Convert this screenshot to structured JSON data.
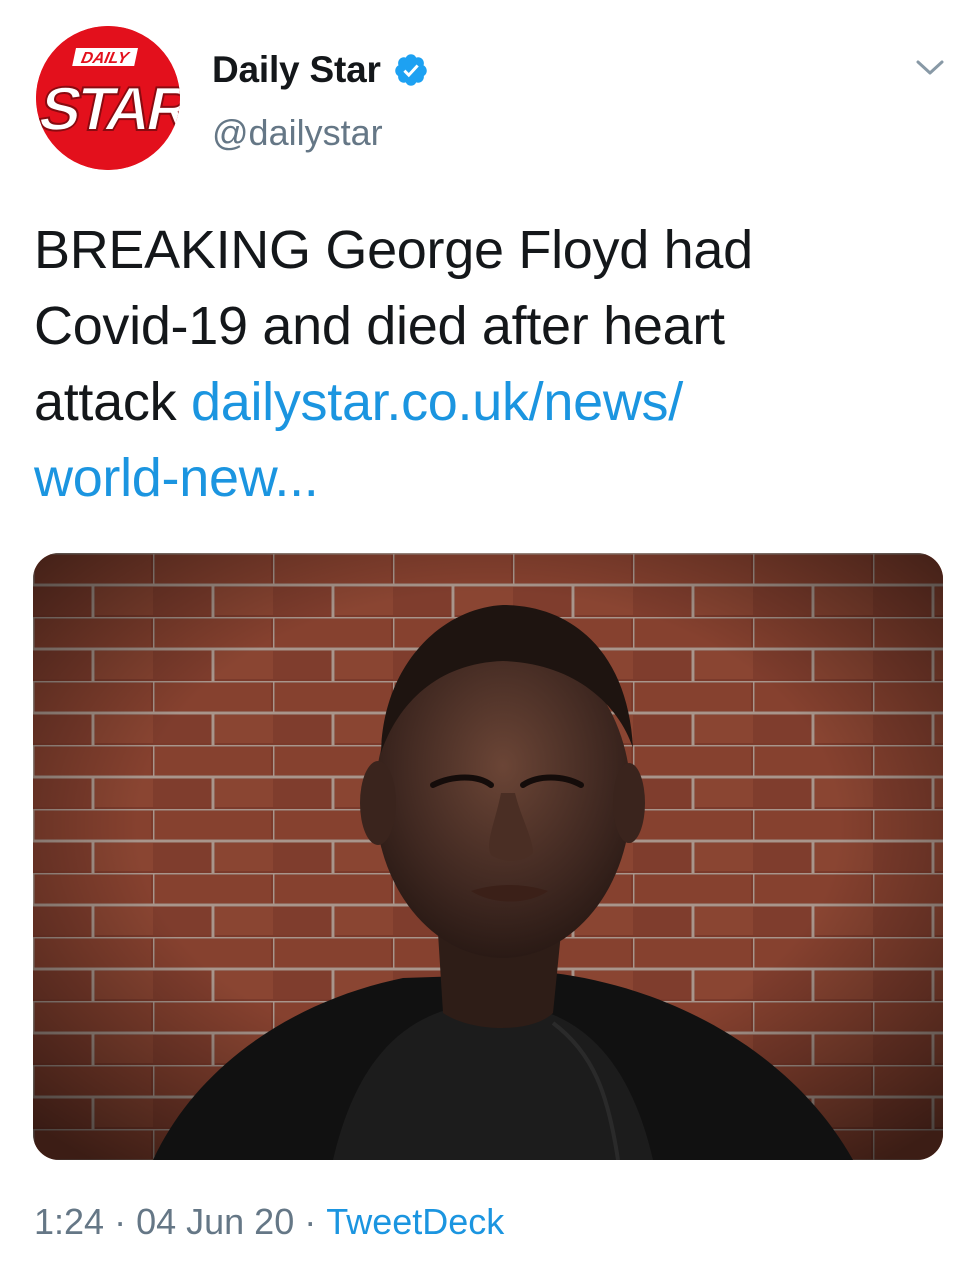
{
  "account": {
    "display_name": "Daily Star",
    "handle": "@dailystar",
    "verified": true,
    "avatar_logo_text": "DAILY STAR",
    "avatar_color": "#e3101c"
  },
  "tweet": {
    "lines": [
      "BREAKING George Floyd had",
      "Covid-19 and died after heart"
    ],
    "line3_text": "attack ",
    "link_part1": "dailystar.co.uk/news/",
    "link_part2": "world-new..."
  },
  "media": {
    "description_icon": "photo-image"
  },
  "footer": {
    "time": "1:24",
    "date": "04 Jun 20",
    "source": "TweetDeck",
    "separator": "·"
  },
  "colors": {
    "link": "#1b95e0",
    "secondary_text": "#657786",
    "primary_text": "#14171a",
    "verified_badge": "#1da1f2"
  },
  "icons": {
    "verified": "verified-badge-icon",
    "more": "chevron-down-icon"
  }
}
